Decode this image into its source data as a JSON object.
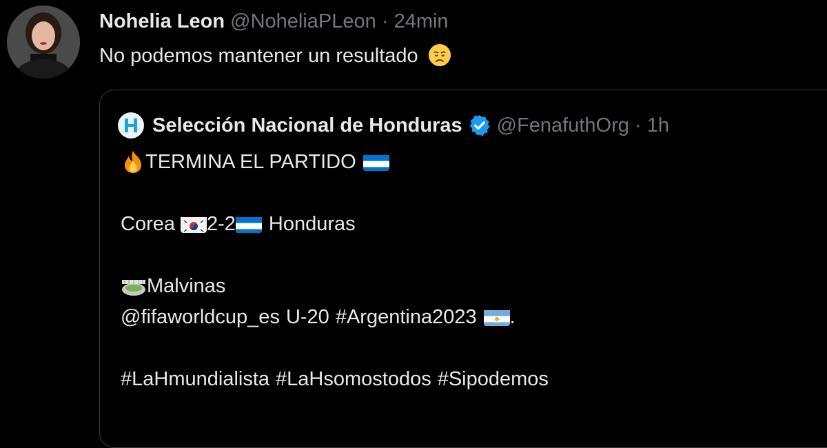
{
  "tweet": {
    "author_name": "Nohelia Leon",
    "handle": "@NoheliaPLeon",
    "separator": "·",
    "time": "24min",
    "text": "No podemos mantener un resultado",
    "emoji": "disappointed-face-icon"
  },
  "quote": {
    "author_name": "Selección Nacional de Honduras",
    "handle": "@FenafuthOrg",
    "separator": "·",
    "time": "1h",
    "line1": "TERMINA EL PARTIDO",
    "line2_a": "Corea",
    "line2_score": "2-2",
    "line2_b": "Honduras",
    "line3": "Malvinas",
    "line4_mention": "@fifaworldcup_es",
    "line4_text": "U-20",
    "line4_hashtag": "#Argentina2023",
    "line4_end": ".",
    "hashtags": [
      "#LaHmundialista",
      "#LaHsomostodos",
      "#Sipodemos"
    ]
  },
  "colors": {
    "background": "#000000",
    "text": "#e7e9ea",
    "muted": "#71767b",
    "verified": "#1d9bf0"
  }
}
